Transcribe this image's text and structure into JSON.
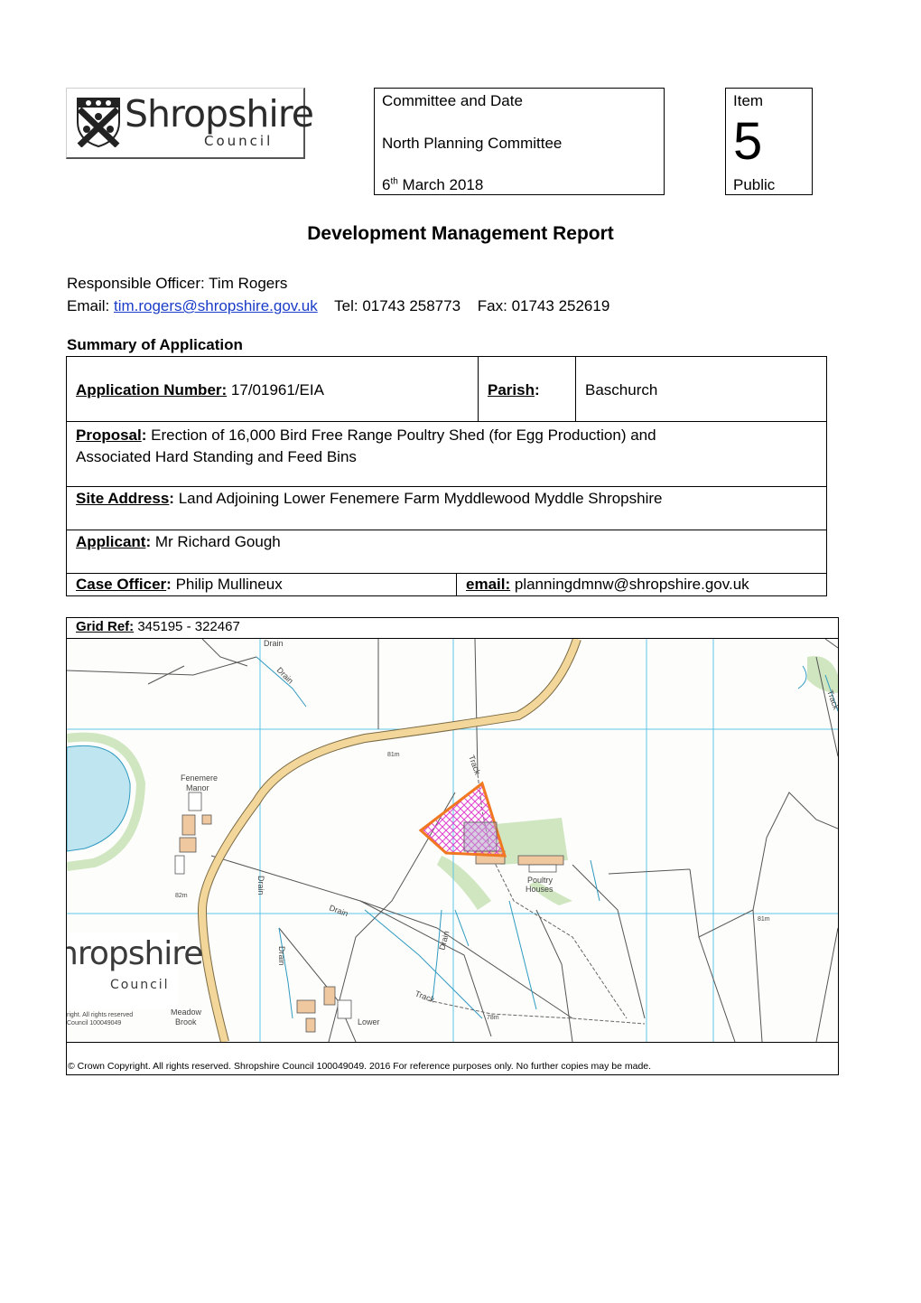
{
  "logo": {
    "main": "Shropshire",
    "sub": "Council",
    "emblem": "council-crest-icon"
  },
  "committee": {
    "heading": "Committee and Date",
    "name": "North Planning Committee",
    "day": "6",
    "day_suffix": "th",
    "month_year": "March 2018"
  },
  "item": {
    "label": "Item",
    "number": "5",
    "status": "Public"
  },
  "title": "Development Management Report",
  "officer": {
    "line": "Responsible Officer: Tim Rogers",
    "email_label": "Email:",
    "email": "tim.rogers@shropshire.gov.uk",
    "tel": "Tel: 01743 258773",
    "fax": "Fax: 01743 252619"
  },
  "summary_heading": "Summary of Application",
  "application": {
    "number_label": "Application Number:",
    "number": "17/01961/EIA",
    "parish_label": "Parish",
    "parish": "Baschurch",
    "proposal_label": "Proposal",
    "proposal_line1": "Erection of 16,000 Bird Free Range Poultry Shed (for Egg Production) and",
    "proposal_line2": "Associated Hard Standing and Feed Bins",
    "site_label": "Site Address",
    "site": "Land Adjoining Lower Fenemere Farm Myddlewood Myddle Shropshire",
    "applicant_label": "Applicant",
    "applicant": "Mr Richard Gough",
    "case_officer_label": "Case Officer",
    "case_officer": "Philip Mullineux",
    "email_label": "email:",
    "email": "planningdmnw@shropshire.gov.uk"
  },
  "map": {
    "grid_ref_label": "Grid Ref:",
    "grid_ref": "345195 - 322467",
    "labels": {
      "fenemere": "Fenemere",
      "manor": "Manor",
      "poultry": "Poultry",
      "houses": "Houses",
      "meadow": "Meadow",
      "brook": "Brook",
      "lower": "Lower",
      "track1": "Track",
      "track2": "Track",
      "drain1": "Drain",
      "drain2": "Drain",
      "drain3": "Drain",
      "drain4": "Drain",
      "drain5": "Drain",
      "drain6": "Drain",
      "h81a": "81m",
      "h81b": "81m",
      "h82": "82m",
      "h78": "78m",
      "mark_a": "Track",
      "copy_a": "right. All rights reserved",
      "copy_b": "Council 100049049"
    },
    "watermark_main": "hropshire",
    "watermark_sub": "Council",
    "colors": {
      "site_outline": "#f07820",
      "site_hatch": "#e040d0",
      "road": "#f3d79a",
      "water": "#bfe6f0",
      "woodland": "#cfe6c0",
      "grid": "#5ec8e8"
    },
    "copyright": "© Crown Copyright. All rights reserved.  Shropshire Council 100049049. 2016  For reference purposes only. No further copies may be made."
  }
}
